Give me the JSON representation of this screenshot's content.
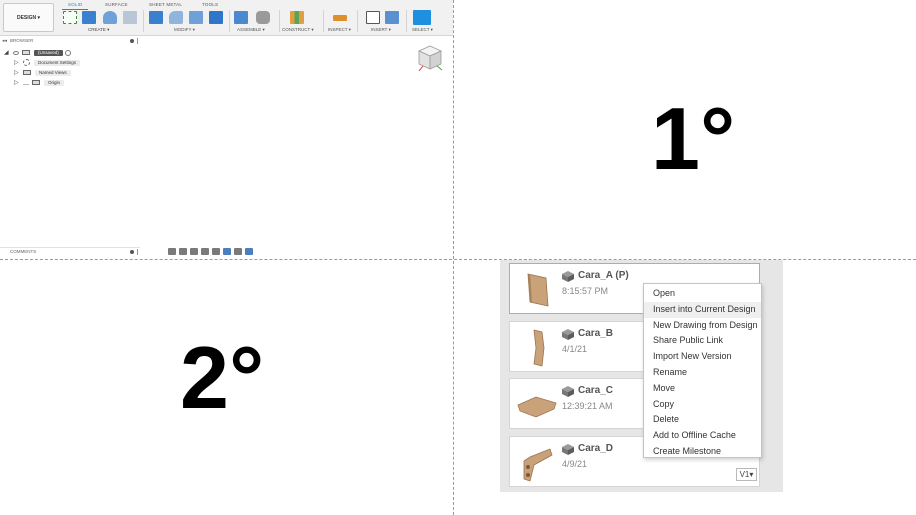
{
  "fusion": {
    "workspace": "DESIGN ▾",
    "tabs": [
      "SOLID",
      "SURFACE",
      "SHEET METAL",
      "TOOLS"
    ],
    "groups": [
      "CREATE ▾",
      "MODIFY ▾",
      "ASSEMBLE ▾",
      "CONSTRUCT ▾",
      "INSPECT ▾",
      "INSERT ▾",
      "SELECT ▾"
    ],
    "browser_title": "BROWSER",
    "tree": [
      {
        "label": "(Unsaved)",
        "icon": "component-icon"
      },
      {
        "label": "Document Settings",
        "icon": "gear-icon"
      },
      {
        "label": "Named Views",
        "icon": "folder-icon"
      },
      {
        "label": "Origin",
        "icon": "folder-icon"
      }
    ],
    "comments_title": "COMMENTS"
  },
  "labels": {
    "first": "1°",
    "second": "2°"
  },
  "files": [
    {
      "name": "Cara_A (P)",
      "date": "8:15:57 PM"
    },
    {
      "name": "Cara_B",
      "date": "4/1/21"
    },
    {
      "name": "Cara_C",
      "date": "12:39:21 AM"
    },
    {
      "name": "Cara_D",
      "date": "4/9/21"
    }
  ],
  "context_menu": [
    "Open",
    "Insert into Current Design",
    "New Drawing from Design",
    "Share Public Link",
    "Import New Version",
    "Rename",
    "Move",
    "Copy",
    "Delete",
    "Add to Offline Cache",
    "Create Milestone"
  ],
  "version_badge": "V1▾",
  "colors": {
    "accent": "#0696d7",
    "wood": "#c9a27a",
    "panel_bg": "#e6e6e6"
  }
}
